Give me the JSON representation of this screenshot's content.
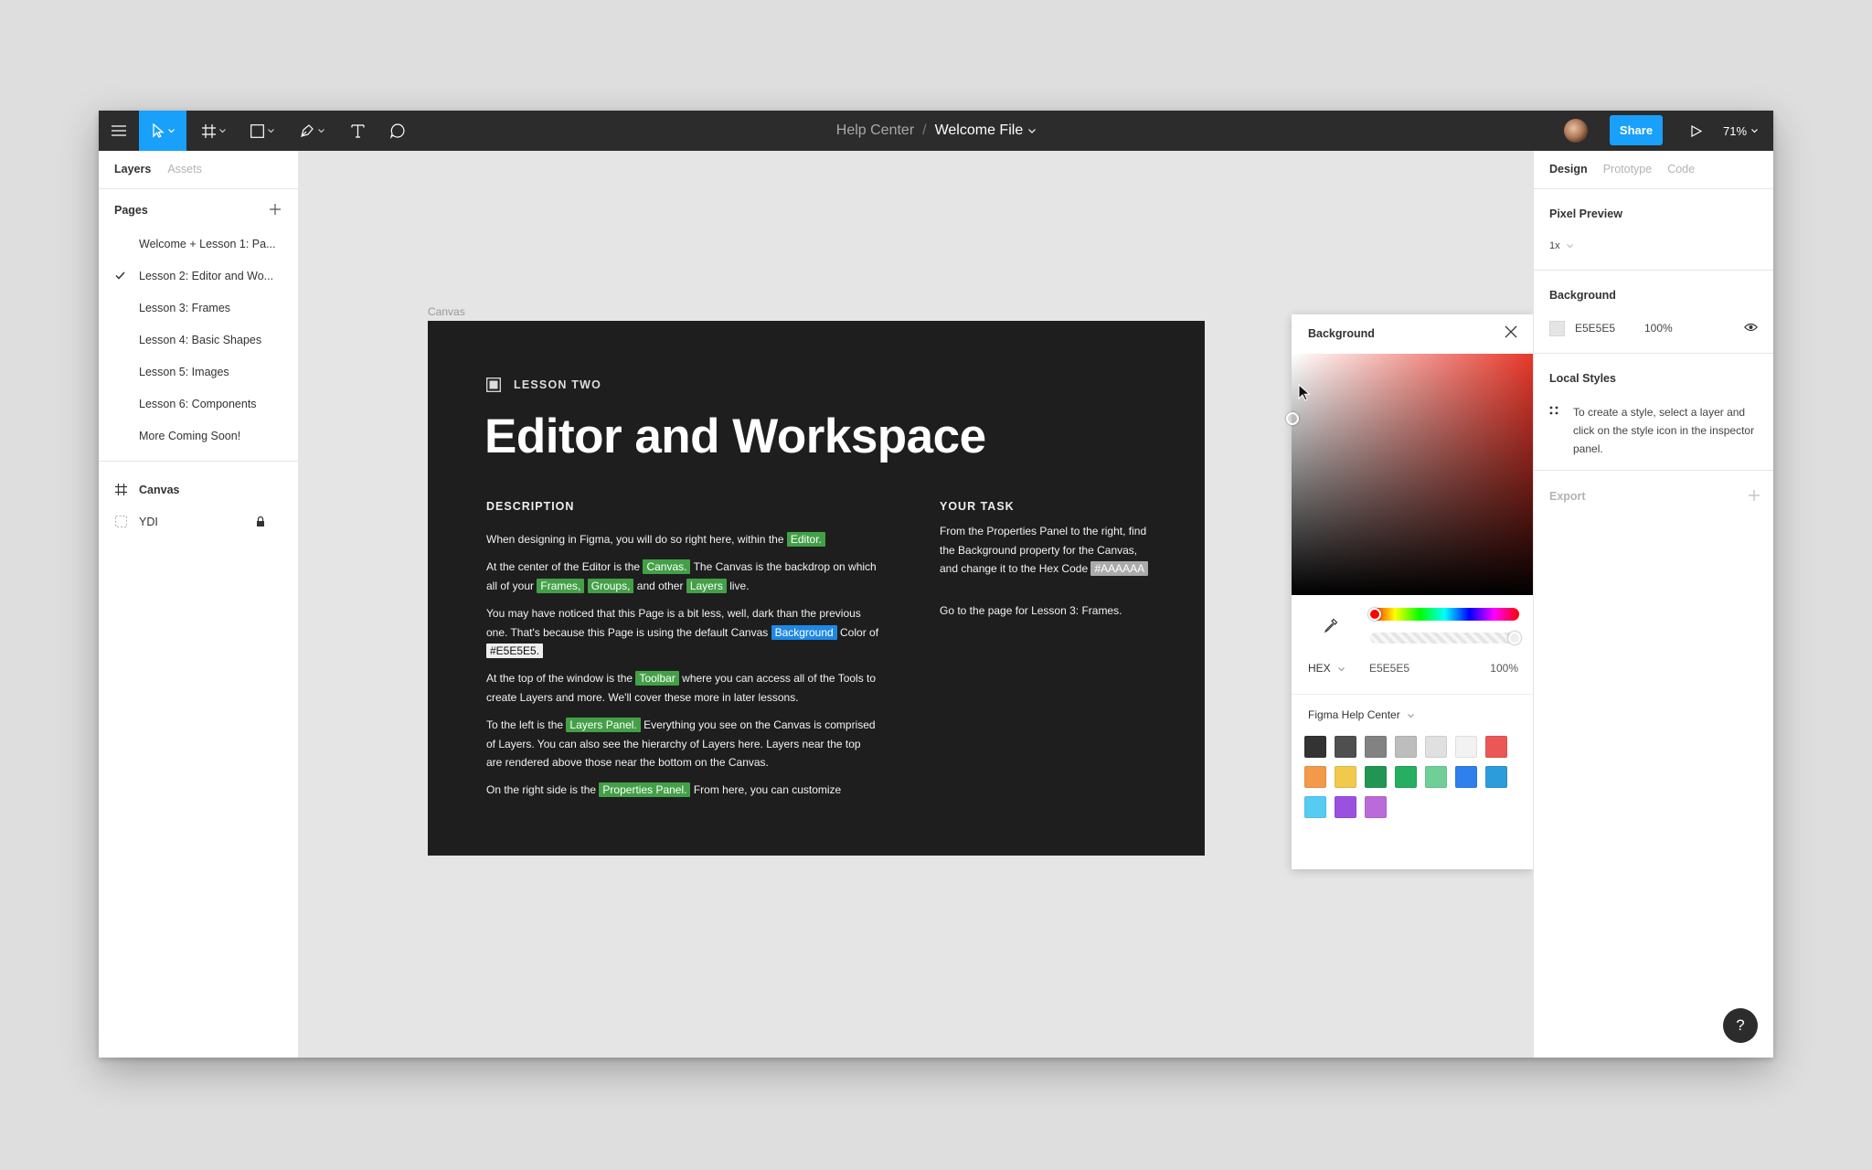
{
  "toolbar": {
    "breadcrumb_project": "Help Center",
    "breadcrumb_sep": "/",
    "file_name": "Welcome File",
    "share_label": "Share",
    "zoom_label": "71%",
    "icons": [
      "menu-icon",
      "move-tool-icon",
      "frame-tool-icon",
      "shape-tool-icon",
      "pen-tool-icon",
      "text-tool-icon",
      "comment-tool-icon",
      "play-icon"
    ]
  },
  "left_panel": {
    "tab_layers": "Layers",
    "tab_assets": "Assets",
    "pages_header": "Pages",
    "pages": [
      {
        "label": "Welcome + Lesson 1: Pa..."
      },
      {
        "label": "Lesson 2: Editor and Wo...",
        "selected": true
      },
      {
        "label": "Lesson 3: Frames"
      },
      {
        "label": "Lesson 4: Basic Shapes"
      },
      {
        "label": "Lesson 5: Images"
      },
      {
        "label": "Lesson 6: Components"
      },
      {
        "label": "More Coming Soon!"
      }
    ],
    "layers": [
      {
        "label": "Canvas",
        "icon": "frame-icon"
      },
      {
        "label": "YDI",
        "icon": "dashed-frame-icon",
        "locked": true
      }
    ]
  },
  "canvas": {
    "label": "Canvas",
    "frame": {
      "kicker": "LESSON TWO",
      "title": "Editor and Workspace",
      "description_header": "DESCRIPTION",
      "task_header": "YOUR TASK",
      "p1_a": "When designing in Figma, you will do so right here, within the",
      "p1_h1": "Editor.",
      "p2_a": "At the center of the Editor is the",
      "p2_h1": "Canvas.",
      "p2_b": "The Canvas is the backdrop on which all of your",
      "p2_h2": "Frames,",
      "p2_h3": "Groups,",
      "p2_c": "and other",
      "p2_h4": "Layers",
      "p2_d": "live.",
      "p3_a": "You may have noticed that this Page is a bit less, well, dark than the previous one. That's because this Page is using the default Canvas",
      "p3_h1": "Background",
      "p3_b": "Color of",
      "p3_h2": "#E5E5E5.",
      "p4_a": "At the top of  the window is the",
      "p4_h1": "Toolbar",
      "p4_b": "where you can access all of the Tools to create Layers and more. We'll cover these more in later lessons.",
      "p5_a": "To the left is the",
      "p5_h1": "Layers Panel.",
      "p5_b": "Everything you see on the Canvas is comprised of Layers. You can also see the hierarchy of Layers here. Layers near the top are rendered above those near the bottom on the Canvas.",
      "p6_a": "On the right side is the",
      "p6_h1": "Properties Panel.",
      "p6_b": "From here, you can customize",
      "t1_a": "From the Properties Panel to the right, find the Background property for the Canvas, and change it to the Hex Code",
      "t1_h1": "#AAAAAA",
      "t2": "Go to the page for Lesson 3: Frames."
    }
  },
  "color_picker": {
    "title": "Background",
    "mode": "HEX",
    "hex_value": "E5E5E5",
    "opacity": "100%",
    "library": "Figma Help Center",
    "swatches": [
      "#333333",
      "#4f4f4f",
      "#828282",
      "#bdbdbd",
      "#e0e0e0",
      "#f2f2f2",
      "#eb5757",
      "#f2994a",
      "#f2c94c",
      "#219653",
      "#27ae60",
      "#6fcf97",
      "#2f80ed",
      "#2d9cdb",
      "#56ccf2",
      "#9b51e0",
      "#bb6bd9"
    ]
  },
  "right_panel": {
    "tab_design": "Design",
    "tab_prototype": "Prototype",
    "tab_code": "Code",
    "pixel_preview_label": "Pixel Preview",
    "pixel_preview_value": "1x",
    "background_label": "Background",
    "background_hex": "E5E5E5",
    "background_opacity": "100%",
    "local_styles_label": "Local Styles",
    "local_styles_hint": "To create a style, select a layer and click on the style icon in the inspector panel.",
    "export_label": "Export"
  },
  "help_button": "?"
}
